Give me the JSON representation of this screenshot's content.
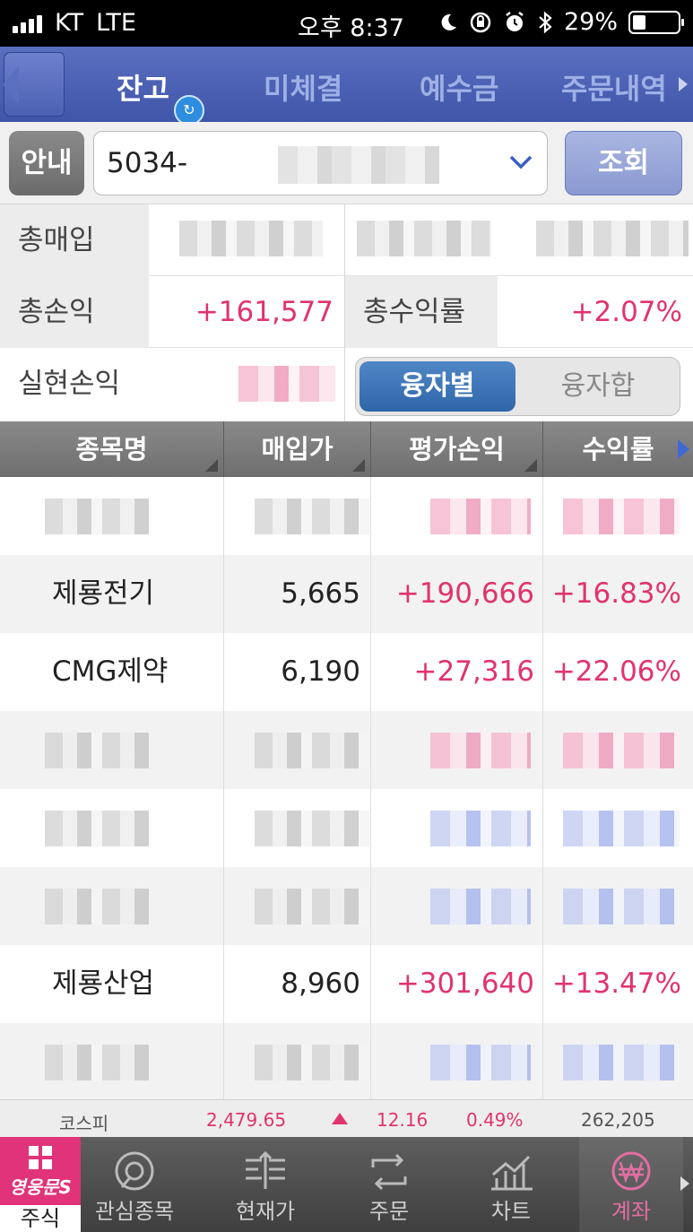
{
  "status": {
    "carrier": "KT",
    "network": "LTE",
    "time": "오후 8:37",
    "battery": "29%",
    "battery_level": 0.29
  },
  "tabs": [
    {
      "label": "잔고",
      "active": true
    },
    {
      "label": "미체결",
      "active": false
    },
    {
      "label": "예수금",
      "active": false
    },
    {
      "label": "주문내역",
      "active": false
    }
  ],
  "account": {
    "info_label": "안내",
    "number": "5034-",
    "query_label": "조회"
  },
  "summary": {
    "total_purchase_label": "총매입",
    "total_pl_label": "총손익",
    "total_pl_value": "+161,577",
    "total_return_label": "총수익률",
    "total_return_value": "+2.07%",
    "realized_pl_label": "실현손익",
    "seg_by_margin": "융자별",
    "seg_margin_sum": "융자합"
  },
  "table": {
    "headers": [
      "종목명",
      "매입가",
      "평가손익",
      "수익률"
    ],
    "rows": [
      {
        "name": "",
        "price": "",
        "pl": "",
        "rate": "",
        "masked": true,
        "tone": "pink"
      },
      {
        "name": "제룡전기",
        "price": "5,665",
        "pl": "+190,666",
        "rate": "+16.83%",
        "masked": false
      },
      {
        "name": "CMG제약",
        "price": "6,190",
        "pl": "+27,316",
        "rate": "+22.06%",
        "masked": false
      },
      {
        "name": "",
        "price": "",
        "pl": "",
        "rate": "",
        "masked": true,
        "tone": "pink"
      },
      {
        "name": "",
        "price": "",
        "pl": "",
        "rate": "",
        "masked": true,
        "tone": "blue"
      },
      {
        "name": "",
        "price": "",
        "pl": "",
        "rate": "",
        "masked": true,
        "tone": "blue"
      },
      {
        "name": "제룡산업",
        "price": "8,960",
        "pl": "+301,640",
        "rate": "+13.47%",
        "masked": false
      },
      {
        "name": "",
        "price": "",
        "pl": "",
        "rate": "",
        "masked": true,
        "tone": "blue"
      }
    ]
  },
  "ticker": {
    "index_name": "코스피",
    "value": "2,479.65",
    "change": "12.16",
    "change_pct": "0.49%",
    "volume": "262,205"
  },
  "nav": {
    "home_brand": "영웅문S",
    "home_label": "주식",
    "items": [
      "관심종목",
      "현재가",
      "주문",
      "차트",
      "계좌"
    ]
  },
  "colors": {
    "header_blue": "#3f55a8",
    "positive": "#e0336f",
    "segment_active": "#2f66a8",
    "brand_pink": "#e0337a"
  }
}
